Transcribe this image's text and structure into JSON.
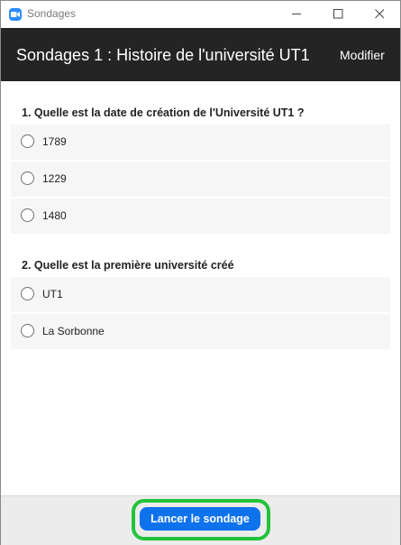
{
  "window": {
    "title": "Sondages",
    "app_icon": "zoom-camera-icon"
  },
  "header": {
    "title": "Sondages 1 : Histoire de l'université UT1",
    "edit_label": "Modifier"
  },
  "questions": [
    {
      "text": "1. Quelle est la date de création de l'Université UT1 ?",
      "options": [
        "1789",
        "1229",
        "1480"
      ]
    },
    {
      "text": "2. Quelle est la première université créé",
      "options": [
        "UT1",
        "La Sorbonne"
      ]
    }
  ],
  "footer": {
    "launch_label": "Lancer le sondage",
    "highlight_color": "#22c33b",
    "button_color": "#0e72ed"
  }
}
